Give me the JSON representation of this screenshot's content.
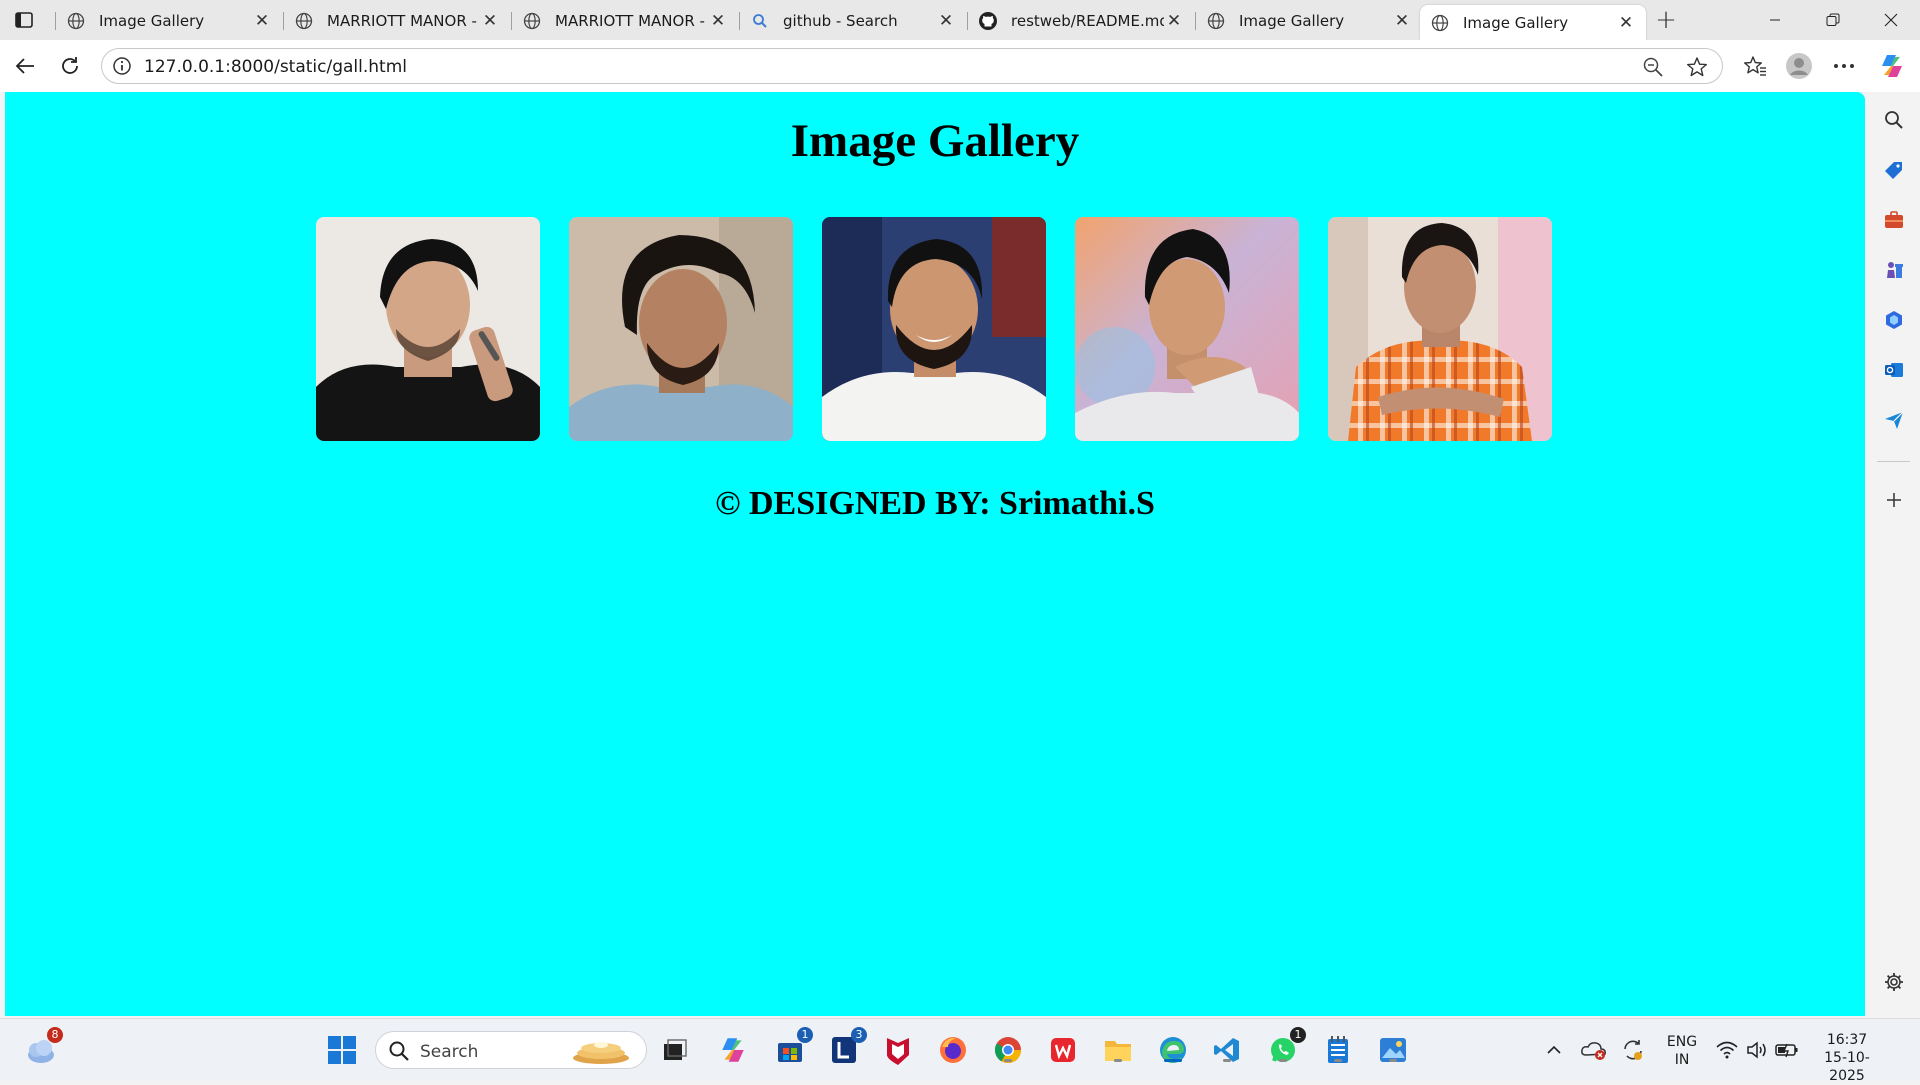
{
  "browser": {
    "tabs": [
      {
        "title": "Image Gallery",
        "favicon": "globe-icon",
        "active": false
      },
      {
        "title": "MARRIOTT MANOR - A",
        "favicon": "globe-icon",
        "active": false
      },
      {
        "title": "MARRIOTT MANOR - A",
        "favicon": "globe-icon",
        "active": false
      },
      {
        "title": "github - Search",
        "favicon": "search-icon",
        "active": false
      },
      {
        "title": "restweb/README.md a",
        "favicon": "github-icon",
        "active": false
      },
      {
        "title": "Image Gallery",
        "favicon": "globe-icon",
        "active": false
      },
      {
        "title": "Image Gallery",
        "favicon": "globe-icon",
        "active": true
      }
    ],
    "url": "127.0.0.1:8000/static/gall.html"
  },
  "page": {
    "title": "Image Gallery",
    "photos": [
      {
        "name": "gallery-photo-1",
        "subject": "man-in-black-shirt"
      },
      {
        "name": "gallery-photo-2",
        "subject": "man-in-denim-shirt"
      },
      {
        "name": "gallery-photo-3",
        "subject": "smiling-man-in-white-shirt"
      },
      {
        "name": "gallery-photo-4",
        "subject": "man-with-hand-on-chin"
      },
      {
        "name": "gallery-photo-5",
        "subject": "man-in-orange-checked-shirt"
      }
    ],
    "footer": "© DESIGNED BY: Srimathi.S",
    "background_color": "#00ffff"
  },
  "taskbar": {
    "weather_badge": "8",
    "search_placeholder": "Search",
    "store_badge": "1",
    "lens_badge": "3",
    "whatsapp_badge": "1",
    "language_line1": "ENG",
    "language_line2": "IN",
    "time": "16:37",
    "date": "15-10-2025"
  },
  "colors": {
    "accent": "#0067c0",
    "page_background": "#00ffff"
  }
}
